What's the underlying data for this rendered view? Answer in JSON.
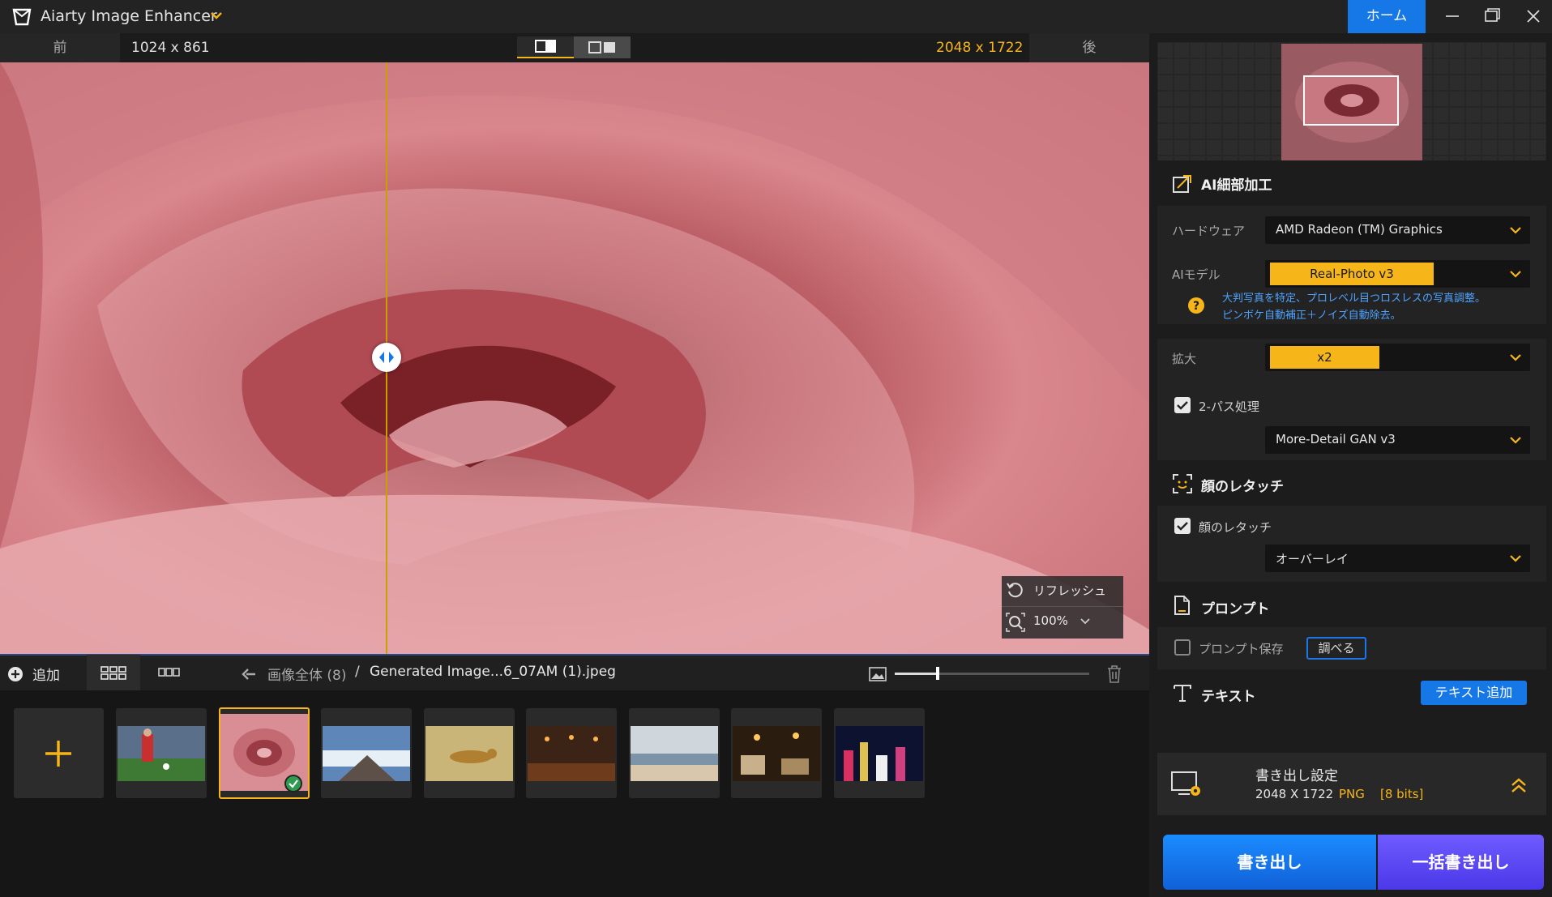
{
  "app": {
    "title": "Aiarty Image Enhancer"
  },
  "window": {
    "home_label": "ホーム"
  },
  "compare": {
    "before_label": "前",
    "before_size": "1024 x 861",
    "after_size": "2048 x 1722",
    "after_label": "後",
    "split_position_fraction": 0.336
  },
  "overlay": {
    "refresh_label": "リフレッシュ",
    "zoom_label": "100%"
  },
  "thumbbar": {
    "add_label": "追加",
    "crumb_root": "画像全体 (8)",
    "crumb_sep": "/",
    "crumb_file": "Generated Image...6_07AM (1).jpeg",
    "thumb_size_fraction": 0.22
  },
  "thumbnails": [
    {
      "icon": "soccer-photo"
    },
    {
      "icon": "rose-photo",
      "selected": true
    },
    {
      "icon": "mountain-photo"
    },
    {
      "icon": "cheetah-photo"
    },
    {
      "icon": "restaurant-photo"
    },
    {
      "icon": "beach-photo"
    },
    {
      "icon": "lounge-photo"
    },
    {
      "icon": "city-night-photo"
    }
  ],
  "detail": {
    "title": "AI細部加工",
    "hardware_label": "ハードウェア",
    "hardware_value": "AMD Radeon (TM) Graphics",
    "model_label": "AIモデル",
    "model_value": "Real-Photo  v3",
    "model_desc_1": "大判写真を特定、プロレベル目つロスレスの写真調整。",
    "model_desc_2": "ピンボケ自動補正＋ノイズ自動除去。",
    "scale_label": "拡大",
    "scale_value": "x2",
    "twopass_label": "2-パス処理",
    "twopass_model": "More-Detail GAN  v3"
  },
  "face": {
    "title": "顔のレタッチ",
    "check_label": "顔のレタッチ",
    "mode_value": "オーバーレイ"
  },
  "prompt": {
    "title": "プロンプト",
    "save_label": "プロンプト保存",
    "investigate_label": "調べる"
  },
  "text": {
    "title": "テキスト",
    "add_label": "テキスト追加"
  },
  "export": {
    "title": "書き出し設定",
    "resolution": "2048 X 1722",
    "format": "PNG",
    "bits": "[8 bits]",
    "export_label": "書き出し",
    "batch_label": "一括書き出し"
  },
  "colors": {
    "accent": "#f6b61a",
    "primary": "#1677e6",
    "batch": "#5a46f0"
  }
}
